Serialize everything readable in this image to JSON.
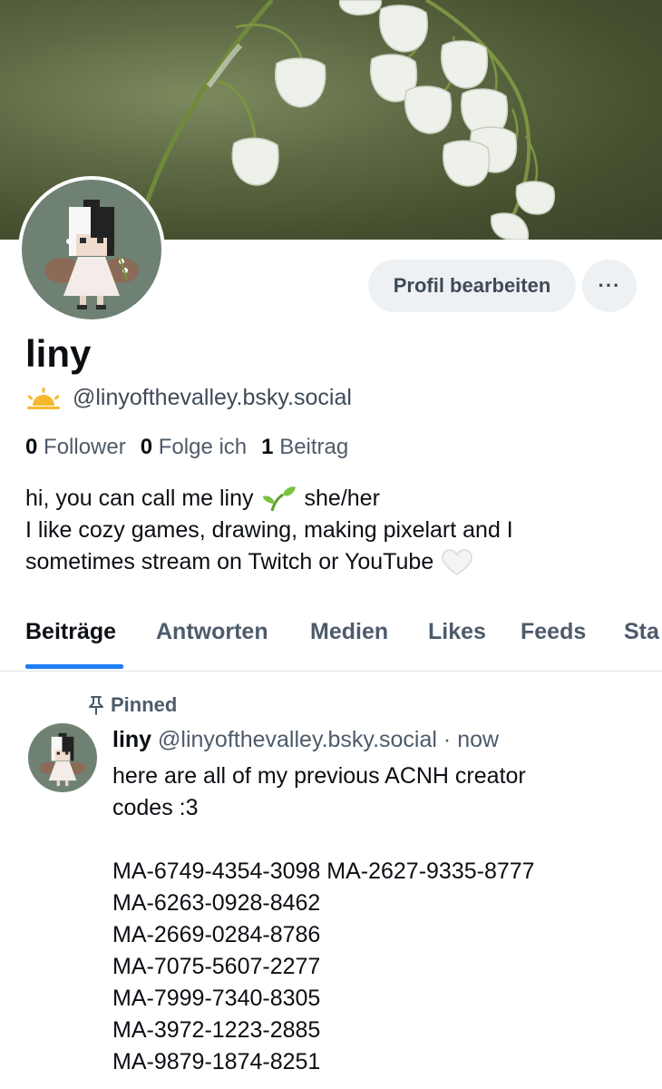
{
  "profile": {
    "display_name": "liny",
    "handle": "@linyofthevalley.bsky.social",
    "edit_button_label": "Profil bearbeiten",
    "more_button_label": "···",
    "handle_icon": "sunrise-icon",
    "stats": {
      "followers_count": "0",
      "followers_label": "Follower",
      "following_count": "0",
      "following_label": "Folge ich",
      "posts_count": "1",
      "posts_label": "Beitrag"
    },
    "bio": {
      "line1_text": "hi, you can call me liny",
      "line1_suffix": "she/her",
      "line2": "I like cozy games, drawing, making pixelart and I",
      "line3": "sometimes stream on Twitch or YouTube"
    }
  },
  "tabs": [
    {
      "label": "Beiträge",
      "active": true
    },
    {
      "label": "Antworten",
      "active": false
    },
    {
      "label": "Medien",
      "active": false
    },
    {
      "label": "Likes",
      "active": false
    },
    {
      "label": "Feeds",
      "active": false
    },
    {
      "label": "Sta",
      "active": false
    }
  ],
  "post": {
    "pinned_label": "Pinned",
    "author_name": "liny",
    "author_handle": "@linyofthevalley.bsky.social",
    "separator": "·",
    "timestamp": "now",
    "text_line1": "here are all of my previous ACNH creator",
    "text_line2": "codes :3",
    "codes": [
      "MA-6749-4354-3098 MA-2627-9335-8777",
      "MA-6263-0928-8462",
      "MA-2669-0284-8786",
      "MA-7075-5607-2277",
      "MA-7999-7340-8305",
      "MA-3972-1223-2885",
      "MA-9879-1874-8251"
    ]
  },
  "colors": {
    "accent": "#1d7ff5",
    "secondary_text": "#4d5b6a",
    "button_bg": "#eef1f4",
    "avatar_bg": "#6f8173"
  }
}
